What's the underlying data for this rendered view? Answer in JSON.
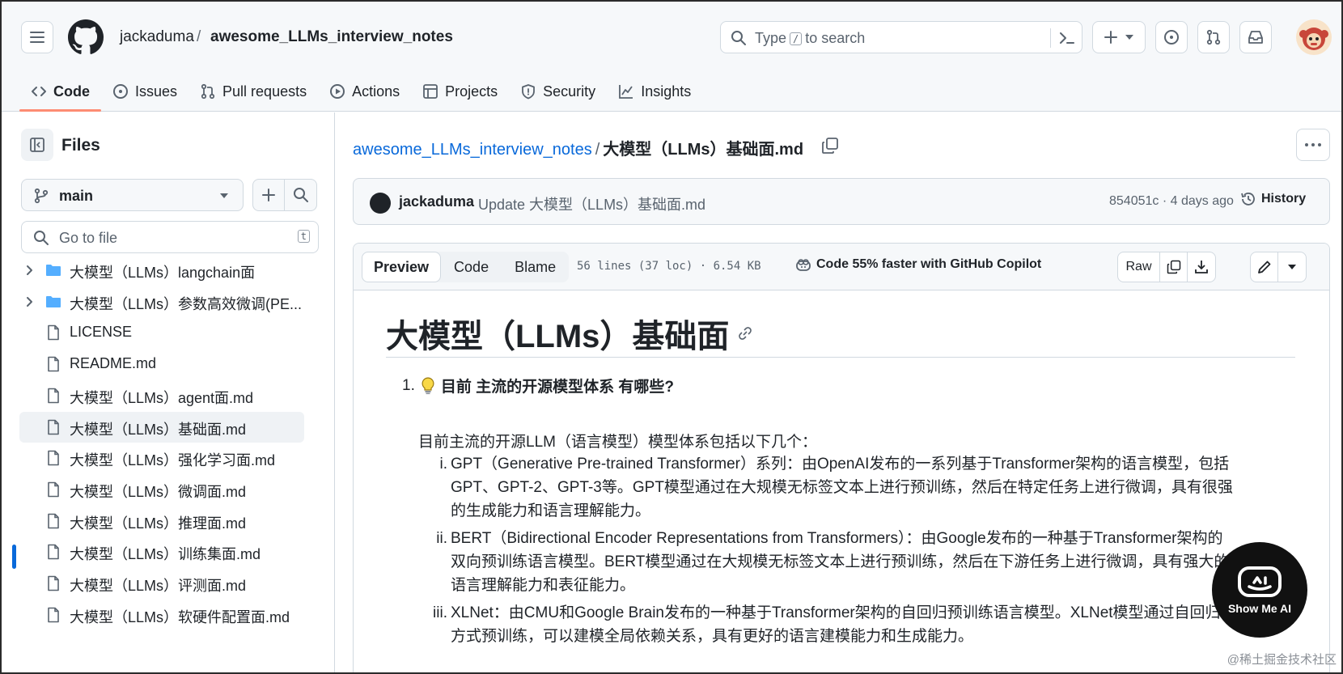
{
  "header": {
    "owner": "jackaduma",
    "separator": "/",
    "repo": "awesome_LLMs_interview_notes",
    "search": {
      "prefix": "Type",
      "key": "/",
      "suffix": "to search"
    }
  },
  "tabs": [
    {
      "label": "Code",
      "icon": "code-icon",
      "active": true
    },
    {
      "label": "Issues",
      "icon": "issue-icon"
    },
    {
      "label": "Pull requests",
      "icon": "pull-request-icon"
    },
    {
      "label": "Actions",
      "icon": "play-icon"
    },
    {
      "label": "Projects",
      "icon": "table-icon"
    },
    {
      "label": "Security",
      "icon": "shield-icon"
    },
    {
      "label": "Insights",
      "icon": "graph-icon"
    }
  ],
  "sidebar": {
    "title": "Files",
    "branch": "main",
    "goto_placeholder": "Go to file",
    "goto_key": "t",
    "items": [
      {
        "label": "大模型（LLMs）langchain面",
        "type": "folder"
      },
      {
        "label": "大模型（LLMs）参数高效微调(PE...",
        "type": "folder"
      },
      {
        "label": "LICENSE",
        "type": "file"
      },
      {
        "label": "README.md",
        "type": "file"
      },
      {
        "label": "大模型（LLMs）agent面.md",
        "type": "file"
      },
      {
        "label": "大模型（LLMs）基础面.md",
        "type": "file",
        "active": true
      },
      {
        "label": "大模型（LLMs）强化学习面.md",
        "type": "file"
      },
      {
        "label": "大模型（LLMs）微调面.md",
        "type": "file"
      },
      {
        "label": "大模型（LLMs）推理面.md",
        "type": "file"
      },
      {
        "label": "大模型（LLMs）训练集面.md",
        "type": "file"
      },
      {
        "label": "大模型（LLMs）评测面.md",
        "type": "file"
      },
      {
        "label": "大模型（LLMs）软硬件配置面.md",
        "type": "file"
      }
    ]
  },
  "main": {
    "breadcrumb_repo": "awesome_LLMs_interview_notes",
    "breadcrumb_sep": "/",
    "breadcrumb_file": "大模型（LLMs）基础面.md",
    "commit": {
      "author": "jackaduma",
      "message": "Update 大模型（LLMs）基础面.md",
      "meta": "854051c · 4 days ago",
      "history": "History"
    },
    "file_tabs": [
      "Preview",
      "Code",
      "Blame"
    ],
    "lines_info": "56 lines (37 loc) · 6.54 KB",
    "copilot": "Code 55% faster with GitHub Copilot",
    "raw": "Raw",
    "content": {
      "title": "大模型（LLMs）基础面",
      "q1_num": "1.",
      "q1": "目前 主流的开源模型体系 有哪些?",
      "intro": "目前主流的开源LLM（语言模型）模型体系包括以下几个：",
      "items": [
        {
          "num": "i.",
          "text": "GPT（Generative Pre-trained Transformer）系列：由OpenAI发布的一系列基于Transformer架构的语言模型，包括GPT、GPT-2、GPT-3等。GPT模型通过在大规模无标签文本上进行预训练，然后在特定任务上进行微调，具有很强的生成能力和语言理解能力。"
        },
        {
          "num": "ii.",
          "text": "BERT（Bidirectional Encoder Representations from Transformers）：由Google发布的一种基于Transformer架构的双向预训练语言模型。BERT模型通过在大规模无标签文本上进行预训练，然后在下游任务上进行微调，具有强大的语言理解能力和表征能力。"
        },
        {
          "num": "iii.",
          "text": "XLNet：由CMU和Google Brain发布的一种基于Transformer架构的自回归预训练语言模型。XLNet模型通过自回归方式预训练，可以建模全局依赖关系，具有更好的语言建模能力和生成能力。"
        }
      ]
    }
  },
  "overlay": {
    "badge": "Show Me AI",
    "watermark": "@稀土掘金技术社区"
  }
}
